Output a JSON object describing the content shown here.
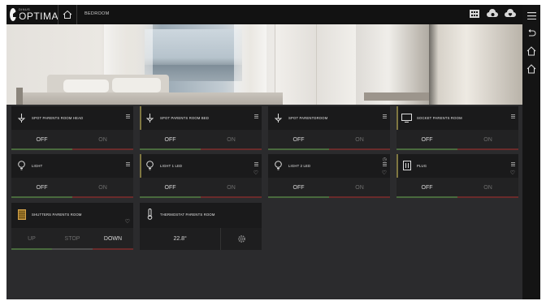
{
  "header": {
    "logo_small": "DINUS",
    "logo_big": "OPTIMA",
    "breadcrumb": "BEDROOM",
    "icons": [
      "grid-icon",
      "cloud-gear-icon",
      "cloud-heart-icon",
      "hamburger-menu-icon"
    ]
  },
  "rail": {
    "icons": [
      "back-icon",
      "home-icon",
      "home-outline-icon"
    ]
  },
  "tiles": [
    {
      "label": "SPOT PARENTS ROOM HEAD",
      "icon": "spotlight-icon",
      "left": "OFF",
      "right": "ON"
    },
    {
      "label": "SPOT PARENTS ROOM BED",
      "icon": "spotlight-icon",
      "left": "OFF",
      "right": "ON"
    },
    {
      "label": "SPOT PARENTDROOM",
      "icon": "spotlight-icon",
      "left": "OFF",
      "right": "ON"
    },
    {
      "label": "SOCKET PARENTS ROOM",
      "icon": "monitor-icon",
      "left": "OFF",
      "right": "ON"
    },
    {
      "label": "LIGHT",
      "icon": "bulb-icon",
      "left": "OFF",
      "right": "ON"
    },
    {
      "label": "LIGHT 1 LED",
      "icon": "bulb-icon",
      "left": "OFF",
      "right": "ON"
    },
    {
      "label": "LIGHT 2 LED",
      "icon": "bulb-icon",
      "left": "OFF",
      "right": "ON"
    },
    {
      "label": "PLUG",
      "icon": "plug-icon",
      "left": "OFF",
      "right": "ON"
    },
    {
      "label": "SHUTTERS PARENTS ROOM",
      "icon": "shutter-icon",
      "buttons": [
        "UP",
        "STOP",
        "DOWN"
      ]
    },
    {
      "label": "THERMOSTAT PARENTS ROOM",
      "icon": "thermometer-icon",
      "temperature": "22.8°"
    }
  ],
  "colors": {
    "background": "#2b2b2d",
    "tile": "#1a1a1b",
    "off_line": "#496a3d",
    "on_line": "#6a2b2b",
    "accent": "#7f7741"
  }
}
